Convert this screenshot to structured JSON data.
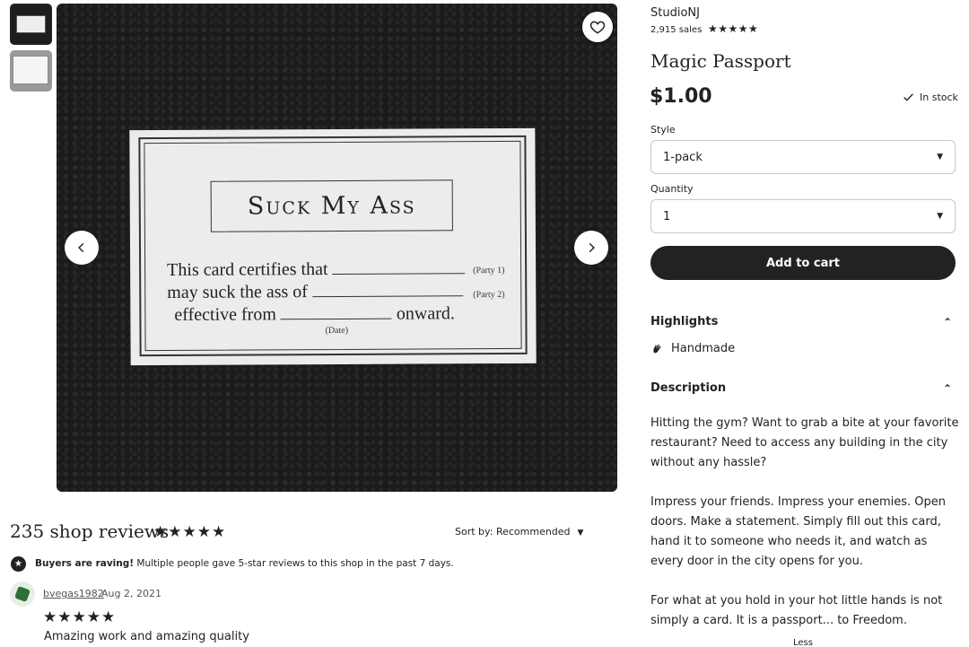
{
  "gallery": {
    "card": {
      "title": "Suck My Ass",
      "line1": "This card certifies that",
      "line1_tag": "(Party 1)",
      "line2": "may suck the ass of",
      "line2_tag": "(Party 2)",
      "line3_start": "effective from",
      "line3_end": "onward.",
      "date_tag": "(Date)"
    }
  },
  "shop": {
    "name": "StudioNJ",
    "sales": "2,915 sales",
    "rating_stars": "★★★★★"
  },
  "product": {
    "title": "Magic Passport",
    "price": "$1.00",
    "stock": "In stock"
  },
  "options": {
    "style_label": "Style",
    "style_value": "1-pack",
    "quantity_label": "Quantity",
    "quantity_value": "1",
    "add_to_cart": "Add to cart"
  },
  "highlights": {
    "heading": "Highlights",
    "items": [
      "Handmade"
    ]
  },
  "description": {
    "heading": "Description",
    "paragraphs": [
      "Hitting the gym? Want to grab a bite at your favorite restaurant? Need to access any building in the city without any hassle?",
      "Impress your friends. Impress your enemies. Open doors. Make a statement. Simply fill out this card, hand it to someone who needs it, and watch as every door in the city opens for you.",
      "For what at you hold in your hot little hands is not simply a card. It is a passport... to Freedom."
    ],
    "toggle": "Less"
  },
  "reviews": {
    "title": "235 shop reviews",
    "stars": "★★★★★",
    "sort": "Sort by: Recommended",
    "raving_bold": "Buyers are raving!",
    "raving_text": "Multiple people gave 5-star reviews to this shop in the past 7 days.",
    "items": [
      {
        "reviewer": "bvegas1982",
        "date": "Aug 2, 2021",
        "stars": "★★★★★",
        "text": "Amazing work and amazing quality"
      }
    ]
  },
  "colors": {
    "text": "#222222",
    "button_bg": "#222222",
    "avatar_green": "#2f6e34"
  },
  "icons": [
    "heart-icon",
    "chevron-left-icon",
    "chevron-right-icon",
    "check-icon",
    "caret-down-icon",
    "chevron-up-icon",
    "hand-icon",
    "star-badge-icon"
  ]
}
